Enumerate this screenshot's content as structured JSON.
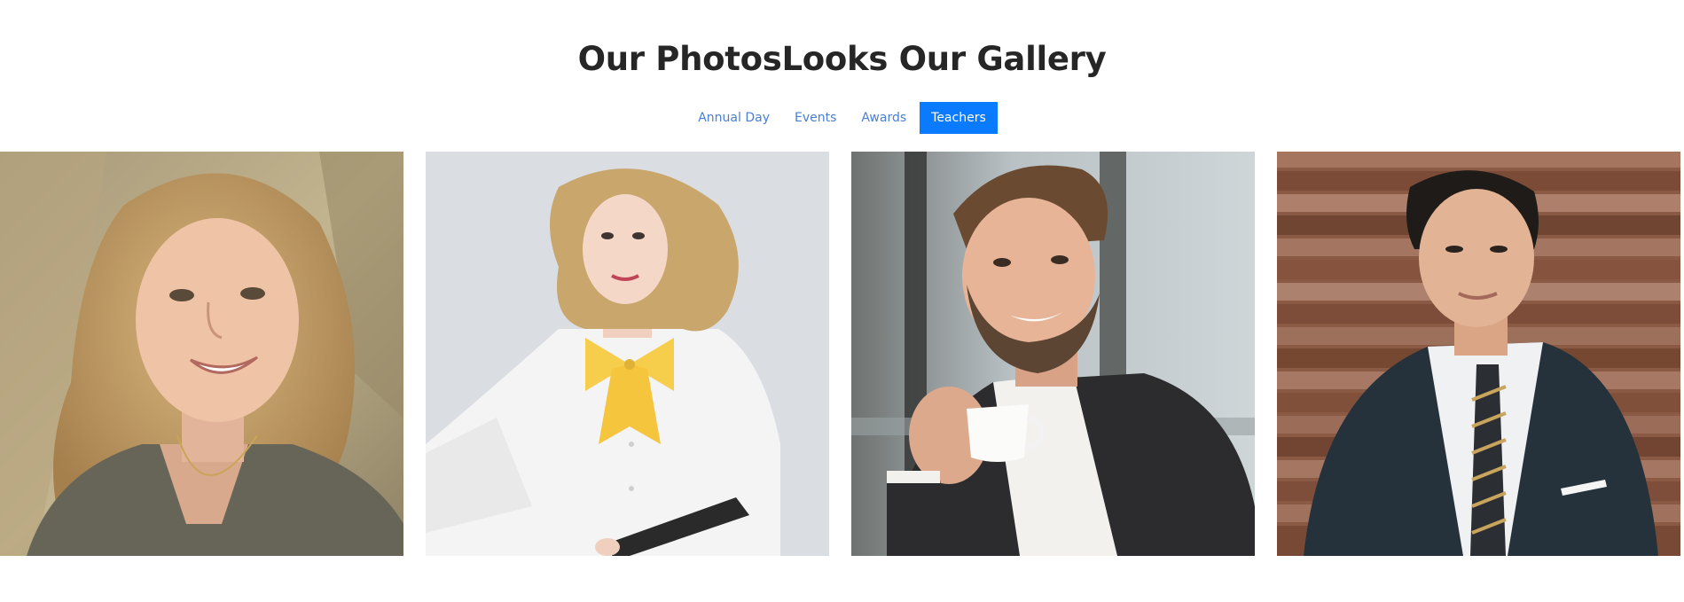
{
  "gallery": {
    "title": "Our PhotosLooks Our Gallery",
    "filters": [
      {
        "label": "Annual Day",
        "active": false
      },
      {
        "label": "Events",
        "active": false
      },
      {
        "label": "Awards",
        "active": false
      },
      {
        "label": "Teachers",
        "active": true
      }
    ],
    "photos": [
      {
        "subject": "smiling blonde woman portrait"
      },
      {
        "subject": "woman with yellow bow tie holding tablet"
      },
      {
        "subject": "bearded man in suit holding coffee cup"
      },
      {
        "subject": "man in dark suit with striped tie"
      }
    ]
  },
  "colors": {
    "accent": "#0a7bff",
    "link": "#4a7fd6",
    "heading": "#262626"
  }
}
